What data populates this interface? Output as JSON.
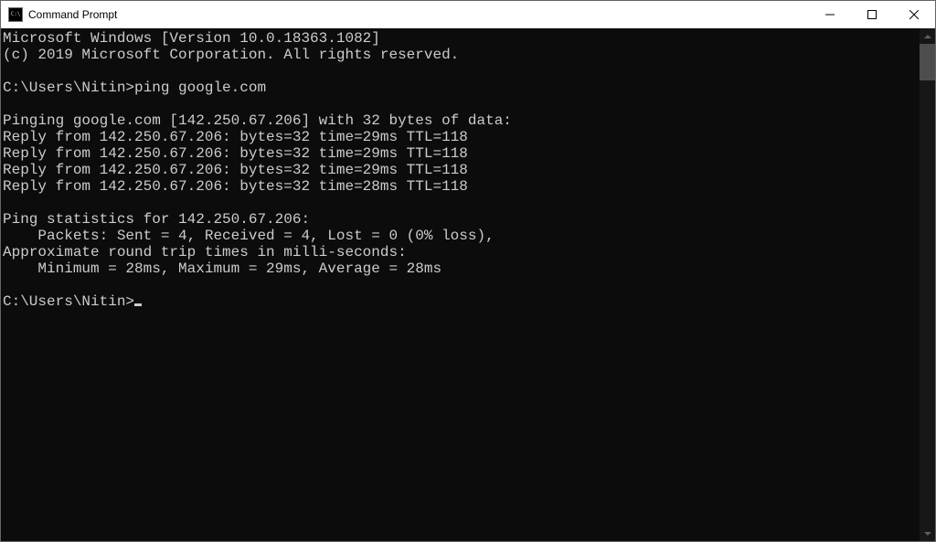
{
  "window": {
    "title": "Command Prompt"
  },
  "terminal": {
    "header1": "Microsoft Windows [Version 10.0.18363.1082]",
    "header2": "(c) 2019 Microsoft Corporation. All rights reserved.",
    "prompt1_path": "C:\\Users\\Nitin>",
    "prompt1_cmd": "ping google.com",
    "pinging": "Pinging google.com [142.250.67.206] with 32 bytes of data:",
    "reply1": "Reply from 142.250.67.206: bytes=32 time=29ms TTL=118",
    "reply2": "Reply from 142.250.67.206: bytes=32 time=29ms TTL=118",
    "reply3": "Reply from 142.250.67.206: bytes=32 time=29ms TTL=118",
    "reply4": "Reply from 142.250.67.206: bytes=32 time=28ms TTL=118",
    "stats_header": "Ping statistics for 142.250.67.206:",
    "stats_packets": "    Packets: Sent = 4, Received = 4, Lost = 0 (0% loss),",
    "stats_rtt_header": "Approximate round trip times in milli-seconds:",
    "stats_rtt": "    Minimum = 28ms, Maximum = 29ms, Average = 28ms",
    "prompt2_path": "C:\\Users\\Nitin>"
  }
}
